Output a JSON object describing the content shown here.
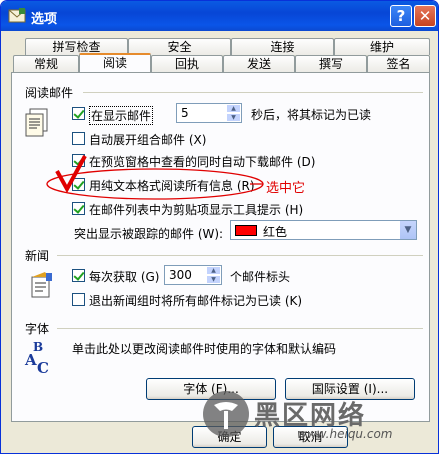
{
  "window": {
    "title": "选项",
    "help_glyph": "?",
    "close_glyph": "✕"
  },
  "tabs": {
    "row_back": [
      "拼写检查",
      "安全",
      "连接",
      "维护"
    ],
    "row_front": [
      "常规",
      "阅读",
      "回执",
      "发送",
      "撰写",
      "签名"
    ],
    "active": "阅读"
  },
  "reading_group": {
    "title": "阅读邮件",
    "mark_read": {
      "label": "在显示邮件",
      "seconds": "5",
      "suffix": "秒后，将其标记为已读",
      "checked": true
    },
    "auto_expand": {
      "label": "自动展开组合邮件 (X)",
      "checked": false
    },
    "auto_download": {
      "label": "在预览窗格中查看的同时自动下载邮件 (D)",
      "checked": true
    },
    "plain_text": {
      "label": "用纯文本格式阅读所有信息 (R)",
      "checked": true
    },
    "tooltip": {
      "label": "在邮件列表中为剪贴项显示工具提示 (H)",
      "checked": true
    },
    "highlight": {
      "label": "突出显示被跟踪的邮件 (W):",
      "value": "红色",
      "swatch_color": "#ff0000"
    }
  },
  "news_group": {
    "title": "新闻",
    "fetch": {
      "label": "每次获取 (G)",
      "value": "300",
      "suffix": "个邮件标头",
      "checked": true
    },
    "mark_on_exit": {
      "label": "退出新闻组时将所有邮件标记为已读 (K)",
      "checked": false
    }
  },
  "fonts_group": {
    "title": "字体",
    "description": "单击此处以更改阅读邮件时使用的字体和默认编码",
    "fonts_button": "字体 (F)...",
    "intl_button": "国际设置 (I)..."
  },
  "footer": {
    "ok": "确定",
    "cancel": "取消"
  },
  "annotation": {
    "text": "选中它",
    "color": "#e00000"
  },
  "watermark": {
    "text": "黑区网络",
    "url": "www.heiqu.com"
  }
}
